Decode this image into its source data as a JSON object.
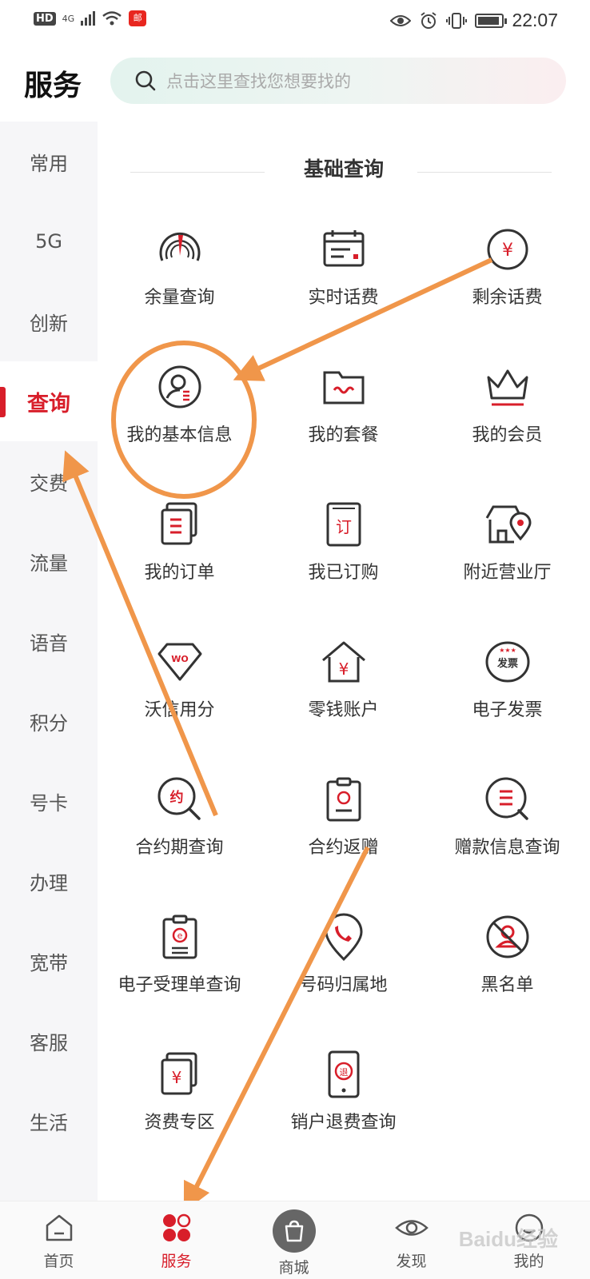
{
  "status_bar": {
    "network_badge": "HD",
    "network_type": "4G",
    "app_badge": "邮",
    "time": "22:07"
  },
  "header": {
    "title": "服务",
    "search_placeholder": "点击这里查找您想要找的"
  },
  "sidebar": {
    "items": [
      {
        "label": "常用"
      },
      {
        "label": "5G"
      },
      {
        "label": "创新"
      },
      {
        "label": "查询"
      },
      {
        "label": "交费"
      },
      {
        "label": "流量"
      },
      {
        "label": "语音"
      },
      {
        "label": "积分"
      },
      {
        "label": "号卡"
      },
      {
        "label": "办理"
      },
      {
        "label": "宽带"
      },
      {
        "label": "客服"
      },
      {
        "label": "生活"
      }
    ],
    "active_index": 3
  },
  "main": {
    "section_title": "基础查询",
    "items": [
      {
        "label": "余量查询",
        "icon": "gauge-icon"
      },
      {
        "label": "实时话费",
        "icon": "bill-icon"
      },
      {
        "label": "剩余话费",
        "icon": "yuan-coin-icon"
      },
      {
        "label": "我的基本信息",
        "icon": "user-info-icon"
      },
      {
        "label": "我的套餐",
        "icon": "folder-wo-icon"
      },
      {
        "label": "我的会员",
        "icon": "crown-icon"
      },
      {
        "label": "我的订单",
        "icon": "order-list-icon"
      },
      {
        "label": "我已订购",
        "icon": "subscribed-icon"
      },
      {
        "label": "附近营业厅",
        "icon": "store-location-icon"
      },
      {
        "label": "沃信用分",
        "icon": "diamond-wo-icon"
      },
      {
        "label": "零钱账户",
        "icon": "house-yuan-icon"
      },
      {
        "label": "电子发票",
        "icon": "invoice-icon"
      },
      {
        "label": "合约期查询",
        "icon": "contract-search-icon"
      },
      {
        "label": "合约返赠",
        "icon": "contract-return-icon"
      },
      {
        "label": "赠款信息查询",
        "icon": "list-search-icon"
      },
      {
        "label": "电子受理单查询",
        "icon": "clipboard-e-icon"
      },
      {
        "label": "号码归属地",
        "icon": "phone-location-icon"
      },
      {
        "label": "黑名单",
        "icon": "blocked-user-icon"
      },
      {
        "label": "资费专区",
        "icon": "tariff-icon"
      },
      {
        "label": "销户退费查询",
        "icon": "refund-phone-icon"
      }
    ]
  },
  "bottom_nav": {
    "items": [
      {
        "label": "首页",
        "icon": "home-icon"
      },
      {
        "label": "服务",
        "icon": "service-icon"
      },
      {
        "label": "商城",
        "icon": "shopping-bag-icon"
      },
      {
        "label": "发现",
        "icon": "eye-icon"
      },
      {
        "label": "我的",
        "icon": "profile-icon"
      }
    ],
    "active_index": 1
  },
  "watermark": "Baidu经验",
  "colors": {
    "accent": "#d81e2a",
    "annotation": "#f0964a",
    "sidebar_bg": "#f6f6f8"
  }
}
